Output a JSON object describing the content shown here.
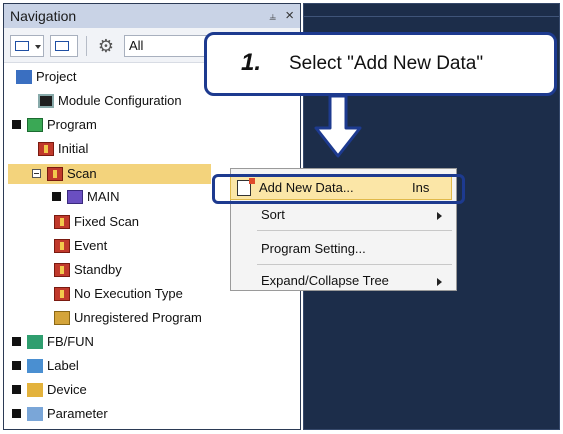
{
  "nav": {
    "title": "Navigation",
    "pin": "I",
    "close": "×",
    "filter_value": "All",
    "tree": [
      {
        "label": "Project"
      },
      {
        "label": "Module Configuration"
      },
      {
        "label": "Program"
      },
      {
        "label": "Initial"
      },
      {
        "label": "Scan"
      },
      {
        "label": "MAIN"
      },
      {
        "label": "Fixed Scan"
      },
      {
        "label": "Event"
      },
      {
        "label": "Standby"
      },
      {
        "label": "No Execution Type"
      },
      {
        "label": "Unregistered Program"
      },
      {
        "label": "FB/FUN"
      },
      {
        "label": "Label"
      },
      {
        "label": "Device"
      },
      {
        "label": "Parameter"
      }
    ]
  },
  "callout": {
    "step": "1.",
    "text": "Select \"Add New Data\""
  },
  "menu": {
    "items": [
      {
        "label": "Add New Data...",
        "shortcut": "Ins"
      },
      {
        "label": "Sort"
      },
      {
        "label": "Program Setting..."
      },
      {
        "label": "Expand/Collapse Tree"
      }
    ]
  },
  "colors": {
    "accent": "#1d3a8f",
    "selection": "#f3d37c",
    "panel_dark": "#1c2d4a"
  }
}
